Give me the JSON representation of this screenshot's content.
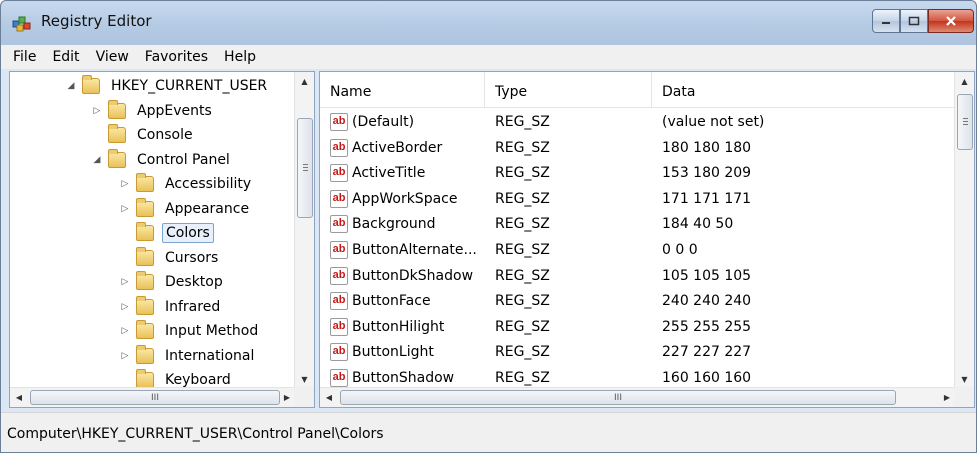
{
  "window": {
    "title": "Registry Editor"
  },
  "caption_buttons": {
    "minimize": "▁",
    "maximize": "□",
    "close": "✕"
  },
  "menu": [
    "File",
    "Edit",
    "View",
    "Favorites",
    "Help"
  ],
  "tree": {
    "items": [
      {
        "label": "HKEY_CURRENT_USER",
        "expander": "◢",
        "level": 0,
        "selected": false
      },
      {
        "label": "AppEvents",
        "expander": "▷",
        "level": 1,
        "selected": false
      },
      {
        "label": "Console",
        "expander": "",
        "level": 1,
        "selected": false
      },
      {
        "label": "Control Panel",
        "expander": "◢",
        "level": 1,
        "selected": false
      },
      {
        "label": "Accessibility",
        "expander": "▷",
        "level": 2,
        "selected": false
      },
      {
        "label": "Appearance",
        "expander": "▷",
        "level": 2,
        "selected": false
      },
      {
        "label": "Colors",
        "expander": "",
        "level": 2,
        "selected": true
      },
      {
        "label": "Cursors",
        "expander": "",
        "level": 2,
        "selected": false
      },
      {
        "label": "Desktop",
        "expander": "▷",
        "level": 2,
        "selected": false
      },
      {
        "label": "Infrared",
        "expander": "▷",
        "level": 2,
        "selected": false
      },
      {
        "label": "Input Method",
        "expander": "▷",
        "level": 2,
        "selected": false
      },
      {
        "label": "International",
        "expander": "▷",
        "level": 2,
        "selected": false
      },
      {
        "label": "Keyboard",
        "expander": "",
        "level": 2,
        "selected": false
      }
    ],
    "hscroll_thumb_label": "III"
  },
  "list": {
    "columns": [
      "Name",
      "Type",
      "Data"
    ],
    "icon_text": "ab",
    "rows": [
      {
        "name": "(Default)",
        "type": "REG_SZ",
        "data": "(value not set)"
      },
      {
        "name": "ActiveBorder",
        "type": "REG_SZ",
        "data": "180 180 180"
      },
      {
        "name": "ActiveTitle",
        "type": "REG_SZ",
        "data": "153 180 209"
      },
      {
        "name": "AppWorkSpace",
        "type": "REG_SZ",
        "data": "171 171 171"
      },
      {
        "name": "Background",
        "type": "REG_SZ",
        "data": "184 40 50"
      },
      {
        "name": "ButtonAlternate...",
        "type": "REG_SZ",
        "data": "0 0 0"
      },
      {
        "name": "ButtonDkShadow",
        "type": "REG_SZ",
        "data": "105 105 105"
      },
      {
        "name": "ButtonFace",
        "type": "REG_SZ",
        "data": "240 240 240"
      },
      {
        "name": "ButtonHilight",
        "type": "REG_SZ",
        "data": "255 255 255"
      },
      {
        "name": "ButtonLight",
        "type": "REG_SZ",
        "data": "227 227 227"
      },
      {
        "name": "ButtonShadow",
        "type": "REG_SZ",
        "data": "160 160 160"
      }
    ],
    "hscroll_thumb_label": "III"
  },
  "statusbar": {
    "path": "Computer\\HKEY_CURRENT_USER\\Control Panel\\Colors"
  }
}
